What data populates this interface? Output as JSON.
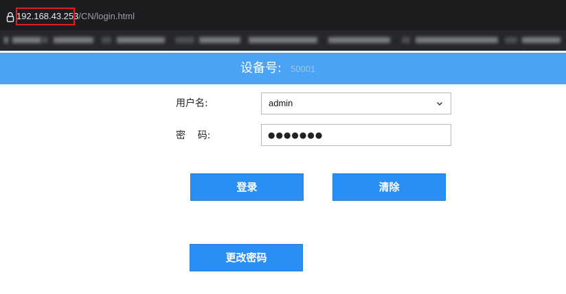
{
  "browser": {
    "url_host": "192.168.43.253",
    "url_path": "/CN/login.html",
    "icons": {
      "security": "lock-icon"
    }
  },
  "page": {
    "device_label": "设备号:",
    "device_value": "50001"
  },
  "form": {
    "username_label": "用户名:",
    "username_value": "admin",
    "password_label": "密    码:",
    "password_value": "●●●●●●●"
  },
  "buttons": {
    "login": "登录",
    "clear": "清除",
    "change_password": "更改密码"
  },
  "colors": {
    "banner": "#4aa3f5",
    "button": "#2a8ff2",
    "highlight": "#e02020"
  }
}
